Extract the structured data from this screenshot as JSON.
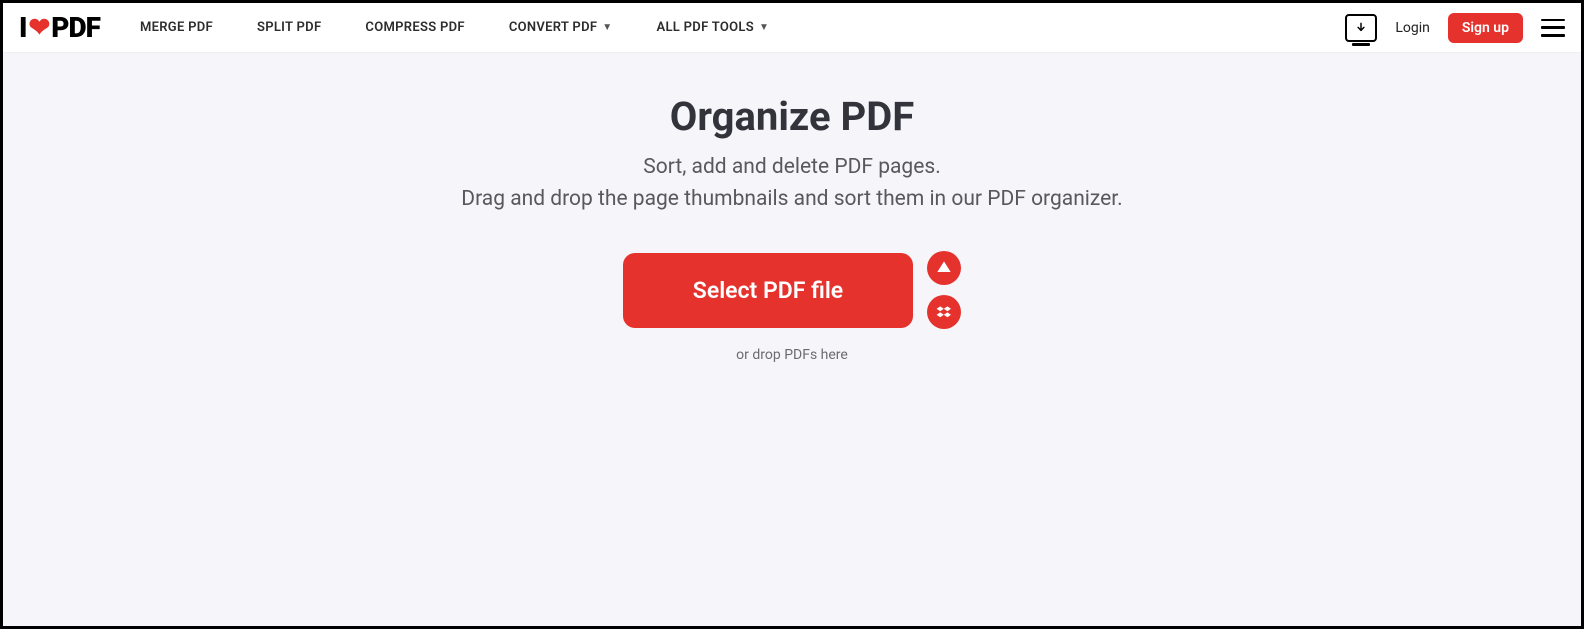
{
  "logo": {
    "pre": "I",
    "post": "PDF"
  },
  "nav": {
    "merge": "MERGE PDF",
    "split": "SPLIT PDF",
    "compress": "COMPRESS PDF",
    "convert": "CONVERT PDF",
    "all_tools": "ALL PDF TOOLS"
  },
  "auth": {
    "login": "Login",
    "signup": "Sign up"
  },
  "main": {
    "title": "Organize PDF",
    "subtitle_line1": "Sort, add and delete PDF pages.",
    "subtitle_line2": "Drag and drop the page thumbnails and sort them in our PDF organizer.",
    "select_button": "Select PDF file",
    "drop_hint": "or drop PDFs here"
  },
  "icons": {
    "gdrive": "google-drive",
    "dropbox": "dropbox"
  }
}
